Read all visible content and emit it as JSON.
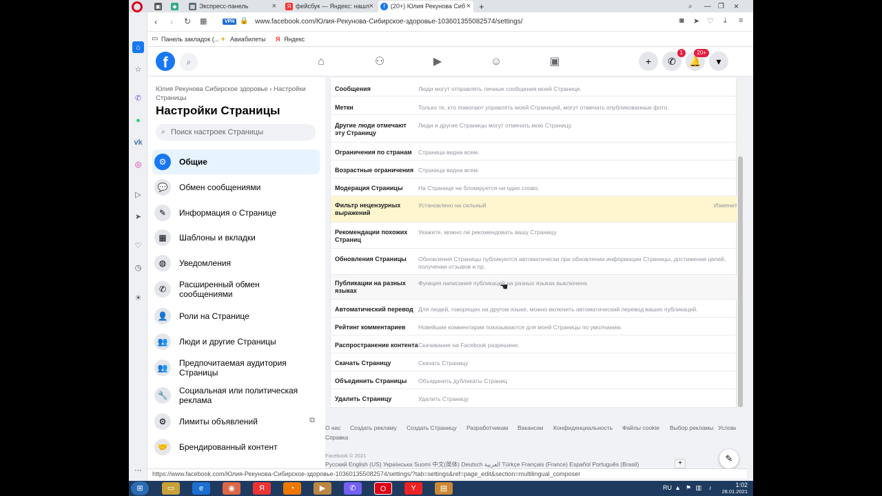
{
  "browser": {
    "tabs": [
      {
        "label": "Экспресс-панель"
      },
      {
        "label": "фейсбук — Яндекс: нашл"
      },
      {
        "label": "(20+) Юлия Рекунова Сиб"
      }
    ],
    "url": "www.facebook.com/Юлия-Рекунова-Сибирское-здоровье-103601355082574/settings/",
    "vpn_label": "VPN",
    "bookmarks": [
      "Панель закладок (...",
      "Авиабилеты",
      "Яндекс"
    ],
    "status_url": "https://www.facebook.com/Юлия-Рекунова-Сибирское-здоровье-103601355082574/settings/?tab=settings&ref=page_edit&section=multilingual_composer"
  },
  "fb_header": {
    "logo": "f",
    "messenger_badge": "1",
    "notifications_badge": "20+"
  },
  "sidebar": {
    "breadcrumb": "Юлия Рекунова Сибирское здоровье › Настройки Страницы",
    "title": "Настройки Страницы",
    "search_placeholder": "Поиск настроек Страницы",
    "items": [
      {
        "label": "Общие",
        "icon": "gear-icon"
      },
      {
        "label": "Обмен сообщениями",
        "icon": "chat-icon"
      },
      {
        "label": "Информация о Странице",
        "icon": "pencil-icon"
      },
      {
        "label": "Шаблоны и вкладки",
        "icon": "grid-icon"
      },
      {
        "label": "Уведомления",
        "icon": "globe-icon"
      },
      {
        "label": "Расширенный обмен сообщениями",
        "icon": "messenger-icon"
      },
      {
        "label": "Роли на Странице",
        "icon": "person-icon"
      },
      {
        "label": "Люди и другие Страницы",
        "icon": "people-icon"
      },
      {
        "label": "Предпочитаемая аудитория Страницы",
        "icon": "audience-icon"
      },
      {
        "label": "Социальная или политическая реклама",
        "icon": "wrench-icon"
      },
      {
        "label": "Лимиты объявлений",
        "icon": "gear-icon"
      },
      {
        "label": "Брендированный контент",
        "icon": "handshake-icon"
      }
    ]
  },
  "settings": [
    {
      "label": "Сообщения",
      "value": "Люди могут отправлять личные сообщения моей Странице."
    },
    {
      "label": "Метки",
      "value": "Только те, кто помогают управлять моей Страницей, могут отмечать опубликованные фото."
    },
    {
      "label": "Другие люди отмечают эту Страницу",
      "value": "Люди и другие Страницы могут отмечать мою Страницу."
    },
    {
      "label": "Ограничения по странам",
      "value": "Страница видна всем."
    },
    {
      "label": "Возрастные ограничения",
      "value": "Страница видна всем."
    },
    {
      "label": "Модерация Страницы",
      "value": "На Странице не блокируется ни одно слово."
    },
    {
      "label": "Фильтр нецензурных выражений",
      "value": "Установлено на сильный",
      "edit": "Изменить"
    },
    {
      "label": "Рекомендации похожих Страниц",
      "value": "Укажите, можно ли рекомендовать вашу Страницу"
    },
    {
      "label": "Обновления Страницы",
      "value": "Обновления Страницы публикуются автоматически при обновлении информации Страницы, достижении целей, получении отзывов и пр."
    },
    {
      "label": "Публикации на разных языках",
      "value": "Функция написания публикаций на разных языках выключена"
    },
    {
      "label": "Автоматический перевод",
      "value": "Для людей, говорящих на другом языке, можно включить автоматический перевод ваших публикаций."
    },
    {
      "label": "Рейтинг комментариев",
      "value": "Новейшие комментарии показываются для моей Страницы по умолчанию."
    },
    {
      "label": "Распространение контента",
      "value": "Скачивание на Facebook разрешено."
    },
    {
      "label": "Скачать Страницу",
      "value": "Скачать Страницу"
    },
    {
      "label": "Объединить Страницы",
      "value": "Объединить дубликаты Страниц"
    },
    {
      "label": "Удалить Страницу",
      "value": "Удалить Страницу"
    }
  ],
  "footer": {
    "links": [
      "О нас",
      "Создать рекламу",
      "Создать Страницу",
      "Разработчикам",
      "Вакансии",
      "Конфиденциальность",
      "Файлы cookie",
      "Выбор рекламы",
      "Условия",
      "Справка"
    ],
    "copyright": "Facebook © 2021",
    "languages": "Русский   English (US)   Українська   Suomi   中文(简体)   Deutsch   العربية   Türkçe   Français (France)   Español   Português (Brasil)"
  },
  "taskbar": {
    "lang": "RU",
    "time": "1:02",
    "date": "28.01.2021"
  },
  "colors": {
    "fb_blue": "#1877f2",
    "highlight_row": "#fff6cf"
  }
}
